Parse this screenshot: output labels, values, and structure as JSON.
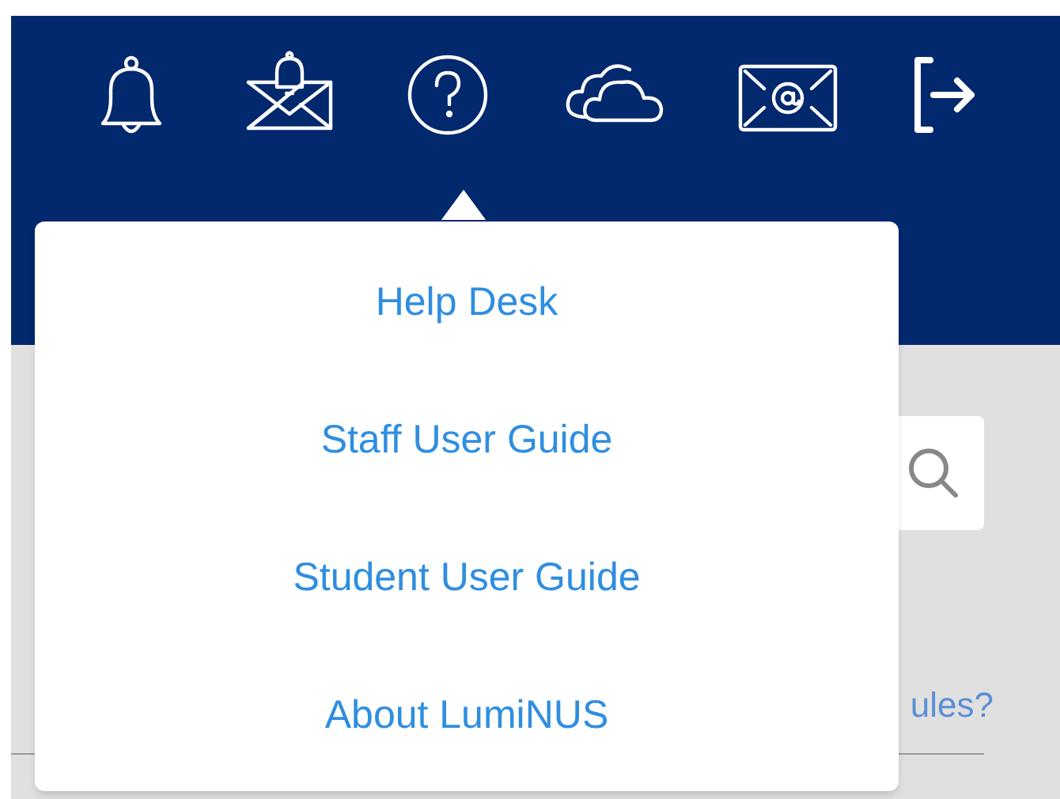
{
  "help_menu": {
    "items": [
      "Help Desk",
      "Staff User Guide",
      "Student User Guide",
      "About LumiNUS"
    ]
  },
  "content": {
    "link": "ules?"
  }
}
